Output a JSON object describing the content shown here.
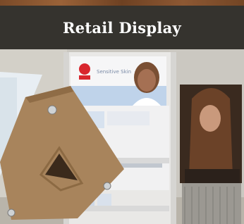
{
  "banner": {
    "title": "Retail Display"
  },
  "photo": {
    "sign_text": "Sensitive Skin"
  },
  "colors": {
    "banner_bg": "#35332e",
    "wood_trim": "#8a5530",
    "cardboard": "#a8845c",
    "brand_red": "#d8262e"
  }
}
